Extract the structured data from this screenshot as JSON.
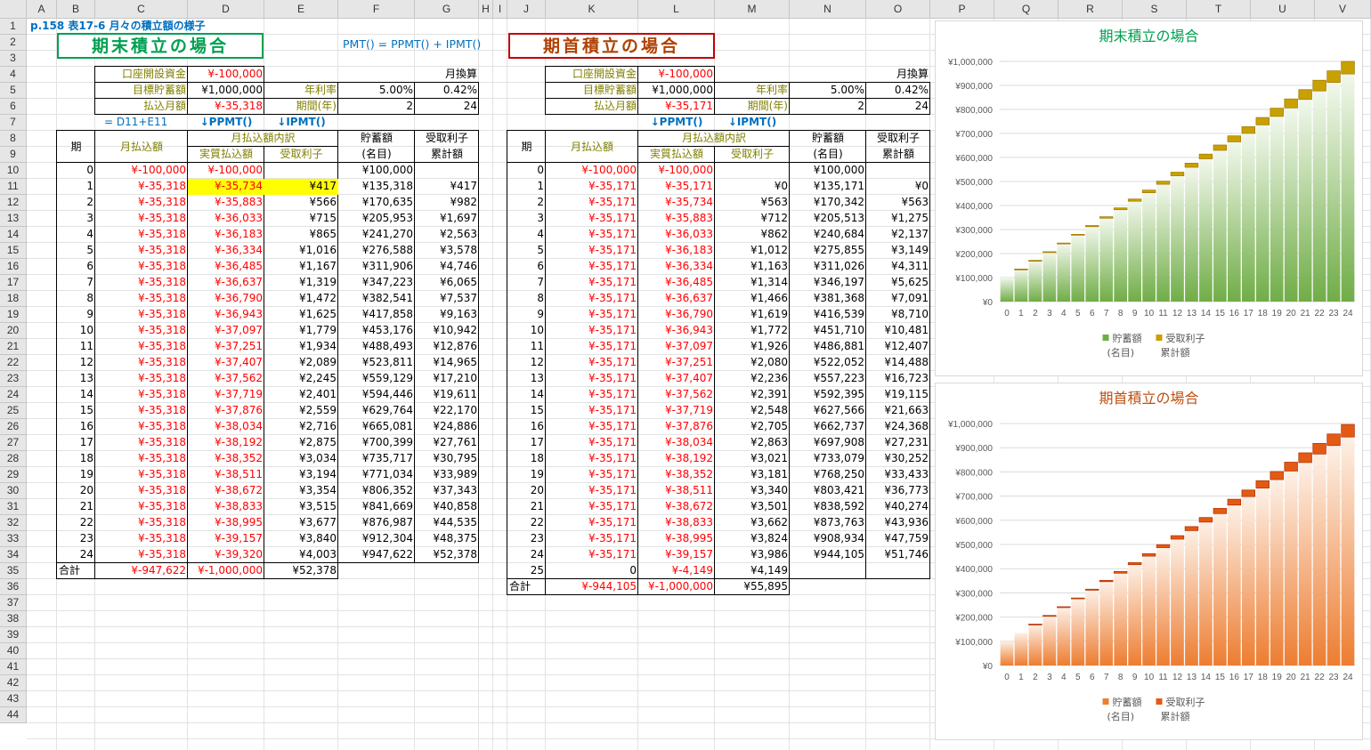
{
  "sheet": {
    "columns": [
      "A",
      "B",
      "C",
      "D",
      "E",
      "F",
      "G",
      "H",
      "I",
      "J",
      "K",
      "L",
      "M",
      "N",
      "O",
      "P",
      "Q",
      "R",
      "S",
      "T",
      "U",
      "V"
    ],
    "rows": [
      "1",
      "2",
      "3",
      "4",
      "5",
      "6",
      "7",
      "8",
      "9",
      "10",
      "11",
      "12",
      "13",
      "14",
      "15",
      "16",
      "17",
      "18",
      "19",
      "20",
      "21",
      "22",
      "23",
      "24",
      "25",
      "26",
      "27",
      "28",
      "29",
      "30",
      "31",
      "32",
      "33",
      "34",
      "35",
      "36",
      "37",
      "38",
      "39",
      "40",
      "41",
      "42",
      "43",
      "44"
    ]
  },
  "header": {
    "title": "p.158 表17-6 月々の積立額の様子",
    "formula_note": "PMT() = PPMT() + IPMT()"
  },
  "colors": {
    "red": "#ff0000",
    "olive": "#808000",
    "blue": "#0070c0",
    "green_banner": "#00a050",
    "red_banner": "#c00000",
    "highlight": "#ffff00"
  },
  "left": {
    "banner": "期末積立の場合",
    "params": {
      "open_label": "口座開設資金",
      "open_value": "¥-100,000",
      "target_label": "目標貯蓄額",
      "target_value": "¥1,000,000",
      "pay_label": "払込月額",
      "pay_value": "¥-35,318",
      "rate_label": "年利率",
      "rate_value": "5.00%",
      "rate_monthly": "0.42%",
      "period_label": "期間(年)",
      "period_value": "2",
      "period_monthly": "24",
      "monthly_label": "月換算"
    },
    "notes": {
      "formula": "= D11+E11",
      "ppmt": "↓PPMT()",
      "ipmt": "↓IPMT()"
    },
    "headers": {
      "period": "期",
      "monthly": "月払込額",
      "breakdown": "月払込額内訳",
      "principal": "実質払込額",
      "interest": "受取利子",
      "savings1": "貯蓄額",
      "savings2": "(名目)",
      "cum1": "受取利子",
      "cum2": "累計額"
    },
    "rows": [
      [
        "0",
        "¥-100,000",
        "¥-100,000",
        "",
        "¥100,000",
        ""
      ],
      [
        "1",
        "¥-35,318",
        "¥-35,734",
        "¥417",
        "¥135,318",
        "¥417"
      ],
      [
        "2",
        "¥-35,318",
        "¥-35,883",
        "¥566",
        "¥170,635",
        "¥982"
      ],
      [
        "3",
        "¥-35,318",
        "¥-36,033",
        "¥715",
        "¥205,953",
        "¥1,697"
      ],
      [
        "4",
        "¥-35,318",
        "¥-36,183",
        "¥865",
        "¥241,270",
        "¥2,563"
      ],
      [
        "5",
        "¥-35,318",
        "¥-36,334",
        "¥1,016",
        "¥276,588",
        "¥3,578"
      ],
      [
        "6",
        "¥-35,318",
        "¥-36,485",
        "¥1,167",
        "¥311,906",
        "¥4,746"
      ],
      [
        "7",
        "¥-35,318",
        "¥-36,637",
        "¥1,319",
        "¥347,223",
        "¥6,065"
      ],
      [
        "8",
        "¥-35,318",
        "¥-36,790",
        "¥1,472",
        "¥382,541",
        "¥7,537"
      ],
      [
        "9",
        "¥-35,318",
        "¥-36,943",
        "¥1,625",
        "¥417,858",
        "¥9,163"
      ],
      [
        "10",
        "¥-35,318",
        "¥-37,097",
        "¥1,779",
        "¥453,176",
        "¥10,942"
      ],
      [
        "11",
        "¥-35,318",
        "¥-37,251",
        "¥1,934",
        "¥488,493",
        "¥12,876"
      ],
      [
        "12",
        "¥-35,318",
        "¥-37,407",
        "¥2,089",
        "¥523,811",
        "¥14,965"
      ],
      [
        "13",
        "¥-35,318",
        "¥-37,562",
        "¥2,245",
        "¥559,129",
        "¥17,210"
      ],
      [
        "14",
        "¥-35,318",
        "¥-37,719",
        "¥2,401",
        "¥594,446",
        "¥19,611"
      ],
      [
        "15",
        "¥-35,318",
        "¥-37,876",
        "¥2,559",
        "¥629,764",
        "¥22,170"
      ],
      [
        "16",
        "¥-35,318",
        "¥-38,034",
        "¥2,716",
        "¥665,081",
        "¥24,886"
      ],
      [
        "17",
        "¥-35,318",
        "¥-38,192",
        "¥2,875",
        "¥700,399",
        "¥27,761"
      ],
      [
        "18",
        "¥-35,318",
        "¥-38,352",
        "¥3,034",
        "¥735,717",
        "¥30,795"
      ],
      [
        "19",
        "¥-35,318",
        "¥-38,511",
        "¥3,194",
        "¥771,034",
        "¥33,989"
      ],
      [
        "20",
        "¥-35,318",
        "¥-38,672",
        "¥3,354",
        "¥806,352",
        "¥37,343"
      ],
      [
        "21",
        "¥-35,318",
        "¥-38,833",
        "¥3,515",
        "¥841,669",
        "¥40,858"
      ],
      [
        "22",
        "¥-35,318",
        "¥-38,995",
        "¥3,677",
        "¥876,987",
        "¥44,535"
      ],
      [
        "23",
        "¥-35,318",
        "¥-39,157",
        "¥3,840",
        "¥912,304",
        "¥48,375"
      ],
      [
        "24",
        "¥-35,318",
        "¥-39,320",
        "¥4,003",
        "¥947,622",
        "¥52,378"
      ]
    ],
    "total": [
      "合計",
      "¥-947,622",
      "¥-1,000,000",
      "¥52,378"
    ]
  },
  "right": {
    "banner": "期首積立の場合",
    "params": {
      "open_label": "口座開設資金",
      "open_value": "¥-100,000",
      "target_label": "目標貯蓄額",
      "target_value": "¥1,000,000",
      "pay_label": "払込月額",
      "pay_value": "¥-35,171",
      "rate_label": "年利率",
      "rate_value": "5.00%",
      "rate_monthly": "0.42%",
      "period_label": "期間(年)",
      "period_value": "2",
      "period_monthly": "24",
      "monthly_label": "月換算"
    },
    "notes": {
      "ppmt": "↓PPMT()",
      "ipmt": "↓IPMT()"
    },
    "headers": {
      "period": "期",
      "monthly": "月払込額",
      "breakdown": "月払込額内訳",
      "principal": "実質払込額",
      "interest": "受取利子",
      "savings1": "貯蓄額",
      "savings2": "(名目)",
      "cum1": "受取利子",
      "cum2": "累計額"
    },
    "rows": [
      [
        "0",
        "¥-100,000",
        "¥-100,000",
        "",
        "¥100,000",
        ""
      ],
      [
        "1",
        "¥-35,171",
        "¥-35,171",
        "¥0",
        "¥135,171",
        "¥0"
      ],
      [
        "2",
        "¥-35,171",
        "¥-35,734",
        "¥563",
        "¥170,342",
        "¥563"
      ],
      [
        "3",
        "¥-35,171",
        "¥-35,883",
        "¥712",
        "¥205,513",
        "¥1,275"
      ],
      [
        "4",
        "¥-35,171",
        "¥-36,033",
        "¥862",
        "¥240,684",
        "¥2,137"
      ],
      [
        "5",
        "¥-35,171",
        "¥-36,183",
        "¥1,012",
        "¥275,855",
        "¥3,149"
      ],
      [
        "6",
        "¥-35,171",
        "¥-36,334",
        "¥1,163",
        "¥311,026",
        "¥4,311"
      ],
      [
        "7",
        "¥-35,171",
        "¥-36,485",
        "¥1,314",
        "¥346,197",
        "¥5,625"
      ],
      [
        "8",
        "¥-35,171",
        "¥-36,637",
        "¥1,466",
        "¥381,368",
        "¥7,091"
      ],
      [
        "9",
        "¥-35,171",
        "¥-36,790",
        "¥1,619",
        "¥416,539",
        "¥8,710"
      ],
      [
        "10",
        "¥-35,171",
        "¥-36,943",
        "¥1,772",
        "¥451,710",
        "¥10,481"
      ],
      [
        "11",
        "¥-35,171",
        "¥-37,097",
        "¥1,926",
        "¥486,881",
        "¥12,407"
      ],
      [
        "12",
        "¥-35,171",
        "¥-37,251",
        "¥2,080",
        "¥522,052",
        "¥14,488"
      ],
      [
        "13",
        "¥-35,171",
        "¥-37,407",
        "¥2,236",
        "¥557,223",
        "¥16,723"
      ],
      [
        "14",
        "¥-35,171",
        "¥-37,562",
        "¥2,391",
        "¥592,395",
        "¥19,115"
      ],
      [
        "15",
        "¥-35,171",
        "¥-37,719",
        "¥2,548",
        "¥627,566",
        "¥21,663"
      ],
      [
        "16",
        "¥-35,171",
        "¥-37,876",
        "¥2,705",
        "¥662,737",
        "¥24,368"
      ],
      [
        "17",
        "¥-35,171",
        "¥-38,034",
        "¥2,863",
        "¥697,908",
        "¥27,231"
      ],
      [
        "18",
        "¥-35,171",
        "¥-38,192",
        "¥3,021",
        "¥733,079",
        "¥30,252"
      ],
      [
        "19",
        "¥-35,171",
        "¥-38,352",
        "¥3,181",
        "¥768,250",
        "¥33,433"
      ],
      [
        "20",
        "¥-35,171",
        "¥-38,511",
        "¥3,340",
        "¥803,421",
        "¥36,773"
      ],
      [
        "21",
        "¥-35,171",
        "¥-38,672",
        "¥3,501",
        "¥838,592",
        "¥40,274"
      ],
      [
        "22",
        "¥-35,171",
        "¥-38,833",
        "¥3,662",
        "¥873,763",
        "¥43,936"
      ],
      [
        "23",
        "¥-35,171",
        "¥-38,995",
        "¥3,824",
        "¥908,934",
        "¥47,759"
      ],
      [
        "24",
        "¥-35,171",
        "¥-39,157",
        "¥3,986",
        "¥944,105",
        "¥51,746"
      ],
      [
        "25",
        "0",
        "¥-4,149",
        "¥4,149",
        "",
        ""
      ]
    ],
    "total": [
      "合計",
      "¥-944,105",
      "¥-1,000,000",
      "¥55,895"
    ]
  },
  "chart_data": [
    {
      "type": "bar",
      "stacked": true,
      "title": "期末積立の場合",
      "categories": [
        "0",
        "1",
        "2",
        "3",
        "4",
        "5",
        "6",
        "7",
        "8",
        "9",
        "10",
        "11",
        "12",
        "13",
        "14",
        "15",
        "16",
        "17",
        "18",
        "19",
        "20",
        "21",
        "22",
        "23",
        "24"
      ],
      "series": [
        {
          "name": "貯蓄額(名目)",
          "color": "#70ad47",
          "values": [
            100000,
            135318,
            170635,
            205953,
            241270,
            276588,
            311906,
            347223,
            382541,
            417858,
            453176,
            488493,
            523811,
            559129,
            594446,
            629764,
            665081,
            700399,
            735717,
            771034,
            806352,
            841669,
            876987,
            912304,
            947622
          ]
        },
        {
          "name": "受取利子累計額",
          "color": "#c8a000",
          "values": [
            0,
            417,
            982,
            1697,
            2563,
            3578,
            4746,
            6065,
            7537,
            9163,
            10942,
            12876,
            14965,
            17210,
            19611,
            22170,
            24886,
            27761,
            30795,
            33989,
            37343,
            40858,
            44535,
            48375,
            52378
          ]
        }
      ],
      "yticks": [
        "¥0",
        "¥100,000",
        "¥200,000",
        "¥300,000",
        "¥400,000",
        "¥500,000",
        "¥600,000",
        "¥700,000",
        "¥800,000",
        "¥900,000",
        "¥1,000,000"
      ],
      "ylim": [
        0,
        1000000
      ],
      "legend": "bottom",
      "legend_labels": [
        [
          "貯蓄額",
          "(名目)"
        ],
        [
          "受取利子",
          "累計額"
        ]
      ]
    },
    {
      "type": "bar",
      "stacked": true,
      "title": "期首積立の場合",
      "categories": [
        "0",
        "1",
        "2",
        "3",
        "4",
        "5",
        "6",
        "7",
        "8",
        "9",
        "10",
        "11",
        "12",
        "13",
        "14",
        "15",
        "16",
        "17",
        "18",
        "19",
        "20",
        "21",
        "22",
        "23",
        "24"
      ],
      "series": [
        {
          "name": "貯蓄額(名目)",
          "color": "#ed7d31",
          "values": [
            100000,
            135171,
            170342,
            205513,
            240684,
            275855,
            311026,
            346197,
            381368,
            416539,
            451710,
            486881,
            522052,
            557223,
            592395,
            627566,
            662737,
            697908,
            733079,
            768250,
            803421,
            838592,
            873763,
            908934,
            944105
          ]
        },
        {
          "name": "受取利子累計額",
          "color": "#e35a14",
          "values": [
            0,
            0,
            563,
            1275,
            2137,
            3149,
            4311,
            5625,
            7091,
            8710,
            10481,
            12407,
            14488,
            16723,
            19115,
            21663,
            24368,
            27231,
            30252,
            33433,
            36773,
            40274,
            43936,
            47759,
            51746
          ]
        }
      ],
      "yticks": [
        "¥0",
        "¥100,000",
        "¥200,000",
        "¥300,000",
        "¥400,000",
        "¥500,000",
        "¥600,000",
        "¥700,000",
        "¥800,000",
        "¥900,000",
        "¥1,000,000"
      ],
      "ylim": [
        0,
        1000000
      ],
      "legend": "bottom",
      "legend_labels": [
        [
          "貯蓄額",
          "(名目)"
        ],
        [
          "受取利子",
          "累計額"
        ]
      ]
    }
  ]
}
